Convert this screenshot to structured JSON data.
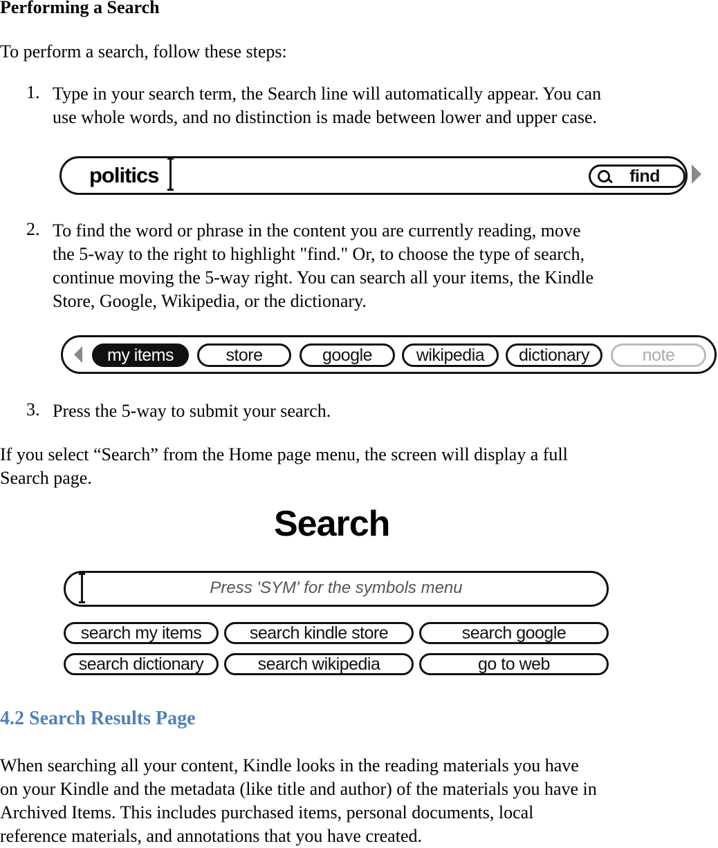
{
  "section_title": "Performing a Search",
  "intro": "To perform a search, follow these steps:",
  "steps": [
    {
      "num": "1.",
      "line1": "Type in your search term, the Search line will automatically appear. You can",
      "line2": "use whole words, and no distinction is made between lower and upper case."
    },
    {
      "num": "2.",
      "line1": "To find the word or phrase in the content you are currently reading, move",
      "line2": "the 5-way to the right to highlight \"find.\" Or, to choose the type of search,",
      "line3": "continue moving the 5-way right. You can search all your items, the Kindle",
      "line4": "Store, Google, Wikipedia, or the dictionary."
    },
    {
      "num": "3.",
      "line1": "Press the 5-way to submit your search."
    }
  ],
  "search_bar": {
    "value": "politics",
    "find_label": "find"
  },
  "scope_bar": {
    "options": [
      "my items",
      "store",
      "google",
      "wikipedia",
      "dictionary",
      "note"
    ],
    "selected": "my items",
    "disabled": "note"
  },
  "home_para": {
    "line1": "If you select “Search” from the Home page menu, the screen will display a full",
    "line2": "Search page."
  },
  "search_page": {
    "title": "Search",
    "placeholder": "Press 'SYM' for the symbols menu",
    "buttons": [
      "search my items",
      "search kindle store",
      "search google",
      "search dictionary",
      "search wikipedia",
      "go to web"
    ]
  },
  "subsection_title": "4.2 Search Results Page",
  "results_para": {
    "line1": "When searching all your content, Kindle looks in the reading materials you have",
    "line2": "on your Kindle and the metadata (like title and author) of the materials you have in",
    "line3": "Archived Items. This includes purchased items, personal documents, local",
    "line4": "reference materials, and annotations that you have created."
  },
  "colors": {
    "heading_blue": "#4F81BD"
  }
}
